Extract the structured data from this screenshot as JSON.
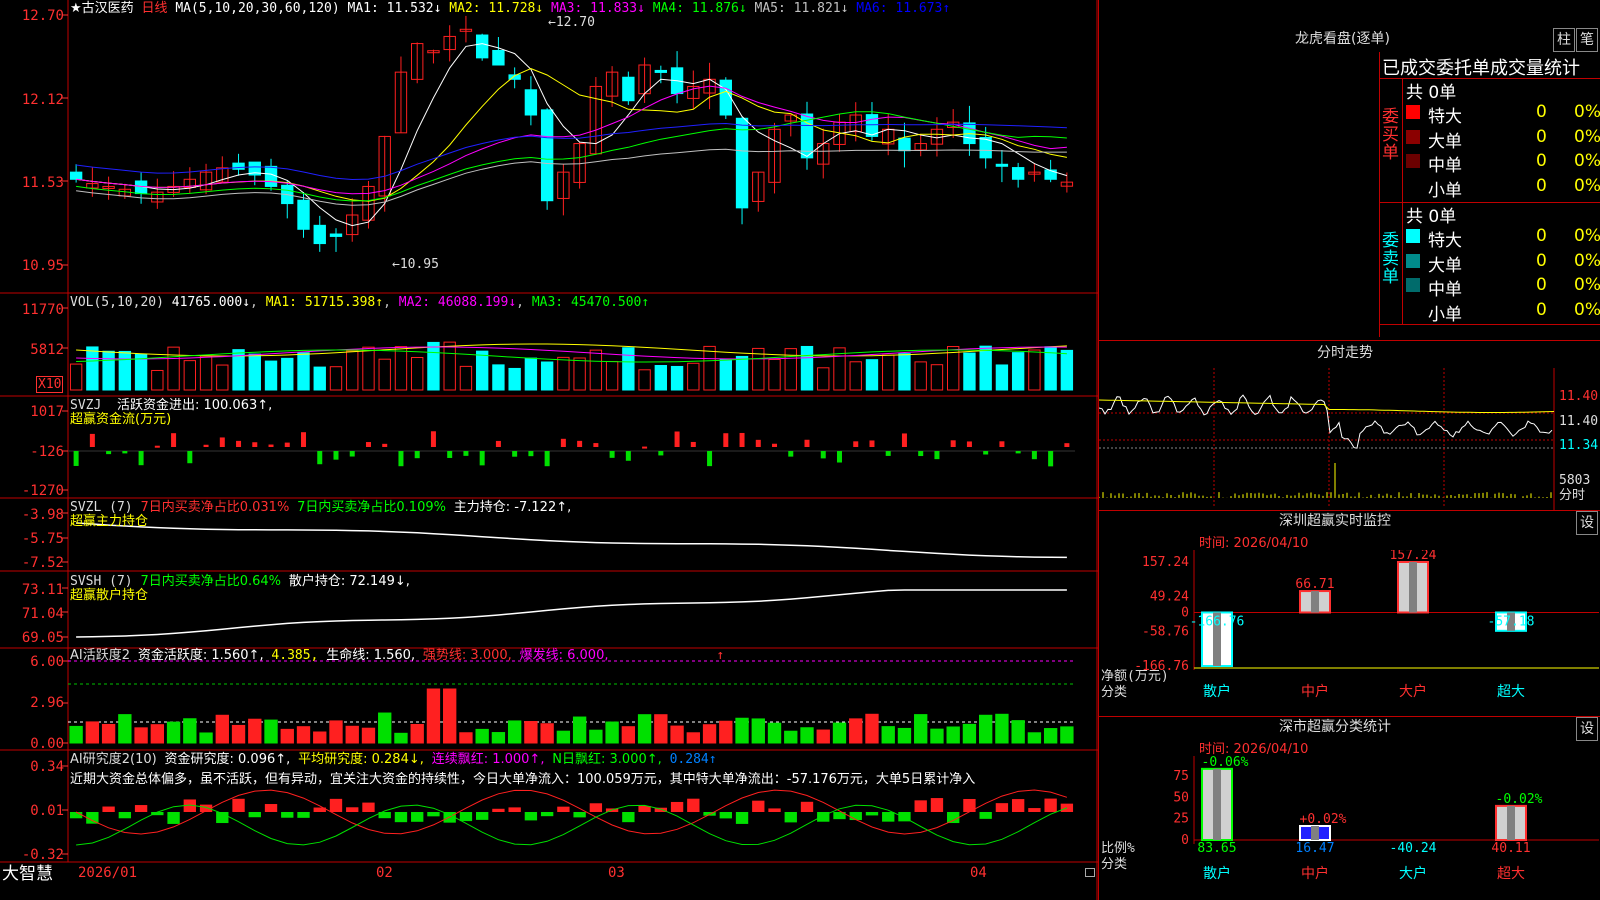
{
  "stock": {
    "name": "★古汉医药",
    "period": "日线",
    "ma_label": "MA(5,10,20,30,60,120)"
  },
  "ma_values": [
    {
      "label": "MA1: 11.532↓",
      "color": "#ffffff"
    },
    {
      "label": "MA2: 11.728↓",
      "color": "#ffff00"
    },
    {
      "label": "MA3: 11.833↓",
      "color": "#ff00ff"
    },
    {
      "label": "MA4: 11.876↓",
      "color": "#00ff00"
    },
    {
      "label": "MA5: 11.821↓",
      "color": "#c0c0c0"
    },
    {
      "label": "MA6: 11.673↑",
      "color": "#0000ff"
    }
  ],
  "price_axis": [
    "12.70",
    "12.12",
    "11.53",
    "10.95"
  ],
  "price_marks": {
    "high": "12.70",
    "low": "10.95"
  },
  "vol_header": {
    "label": "VOL(5,10,20)",
    "v0": "41765.000↓",
    "v1": "MA1: 51715.398↑",
    "v2": "MA2: 46088.199↓",
    "v3": "MA3: 45470.500↑"
  },
  "vol_axis": [
    "11770",
    "5812",
    "X10"
  ],
  "svzj": {
    "label": "SVZJ",
    "text": "活跃资金进出: 100.063↑,",
    "title": "超赢资金流(万元)",
    "axis": [
      "1017",
      "-126",
      "-1270"
    ]
  },
  "svzl": {
    "label": "SVZL (7)",
    "a": "7日内买卖净占比0.031%",
    "b": "7日内买卖净占比0.109%",
    "c": "主力持仓: -7.122↑,",
    "title": "超赢主力持仓",
    "axis": [
      "-3.98",
      "-5.75",
      "-7.52"
    ]
  },
  "svsh": {
    "label": "SVSH (7)",
    "a": "7日内买卖净占比0.64%",
    "b": "散户持仓: 72.149↓,",
    "title": "超赢散户持仓",
    "axis": [
      "73.11",
      "71.04",
      "69.05"
    ]
  },
  "ai1": {
    "label": "AI活跃度2",
    "a": "资金活跃度: 1.560↑,",
    "b": "4.385,",
    "c": "生命线: 1.560,",
    "d": "强势线: 3.000,",
    "e": "爆发线: 6.000,",
    "f": "↑",
    "axis": [
      "6.00",
      "2.96",
      "0.00"
    ]
  },
  "ai2": {
    "label": "AI研究度2(10)",
    "a": "资金研究度: 0.096↑,",
    "b": "平均研究度: 0.284↓,",
    "c": "连续飘红: 1.000↑,",
    "d": "N日飘红: 3.000↑,",
    "e": "0.284↑",
    "axis": [
      "0.34",
      "0.01",
      "-0.32"
    ],
    "comment": "近期大资金总体偏多，虽不活跃，但有异动，宜关注大资金的持续性，今日大单净流入：100.059万元，其中特大单净流出：-57.176万元，大单5日累计净入"
  },
  "xaxis": {
    "brand": "大智慧",
    "dates": [
      "2026/01",
      "02",
      "03",
      "04"
    ]
  },
  "dragon": {
    "title": "龙虎看盘(逐单)",
    "tabs": [
      "柱",
      "笔"
    ],
    "header": "已成交委托单成交量统计",
    "buy": {
      "side": "委买单",
      "total": "共 0单",
      "rows": [
        {
          "name": "特大",
          "val": "0",
          "pct": "0%",
          "color": "#ff0000"
        },
        {
          "name": "大单",
          "val": "0",
          "pct": "0%",
          "color": "#8b0000"
        },
        {
          "name": "中单",
          "val": "0",
          "pct": "0%",
          "color": "#6b0000"
        },
        {
          "name": "小单",
          "val": "0",
          "pct": "0%",
          "color": ""
        }
      ]
    },
    "sell": {
      "side": "委卖单",
      "total": "共 0单",
      "rows": [
        {
          "name": "特大",
          "val": "0",
          "pct": "0%",
          "color": "#00ffff"
        },
        {
          "name": "大单",
          "val": "0",
          "pct": "0%",
          "color": "#008b8b"
        },
        {
          "name": "中单",
          "val": "0",
          "pct": "0%",
          "color": "#006b6b"
        },
        {
          "name": "小单",
          "val": "0",
          "pct": "0%",
          "color": ""
        }
      ]
    }
  },
  "intraday": {
    "title": "分时走势",
    "axis": [
      "11.40",
      "11.40",
      "11.34"
    ],
    "vol": "5803",
    "vol_unit": "分时"
  },
  "sz_monitor": {
    "title": "深圳超赢实时监控",
    "set": "设",
    "date": "时间: 2026/04/10",
    "axis": [
      "157.24",
      "49.24",
      "0",
      "-58.76",
      "-166.76"
    ],
    "ylabel": "净额(万元)",
    "xlabel": "分类",
    "categories": [
      "散户",
      "中户",
      "大户",
      "超大"
    ],
    "values": [
      -166.76,
      66.71,
      157.24,
      -57.18
    ],
    "value_labels": [
      "-166.76",
      "66.71",
      "157.24",
      "-57.18"
    ]
  },
  "sz_class": {
    "title": "深市超赢分类统计",
    "set": "设",
    "date": "时间: 2026/04/10",
    "axis": [
      "75",
      "50",
      "25",
      "0"
    ],
    "ylabel": "比例%",
    "xlabel": "分类",
    "categories": [
      "散户",
      "中户",
      "大户",
      "超大"
    ],
    "top_labels": [
      "-0.06%",
      "+0.02%",
      "",
      "-0.02%"
    ],
    "values": [
      83.65,
      16.47,
      -40.24,
      40.11
    ],
    "value_labels": [
      "83.65",
      "16.47",
      "-40.24",
      "40.11"
    ]
  },
  "chart_data": [
    {
      "type": "bar",
      "title": "深圳超赢实时监控",
      "xlabel": "分类",
      "ylabel": "净额(万元)",
      "categories": [
        "散户",
        "中户",
        "大户",
        "超大"
      ],
      "values": [
        -166.76,
        66.71,
        157.24,
        -57.18
      ],
      "ylim": [
        -166.76,
        157.24
      ]
    },
    {
      "type": "bar",
      "title": "深市超赢分类统计",
      "xlabel": "分类",
      "ylabel": "比例%",
      "categories": [
        "散户",
        "中户",
        "大户",
        "超大"
      ],
      "values": [
        83.65,
        16.47,
        -40.24,
        40.11
      ],
      "ylim": [
        0,
        90
      ]
    }
  ]
}
